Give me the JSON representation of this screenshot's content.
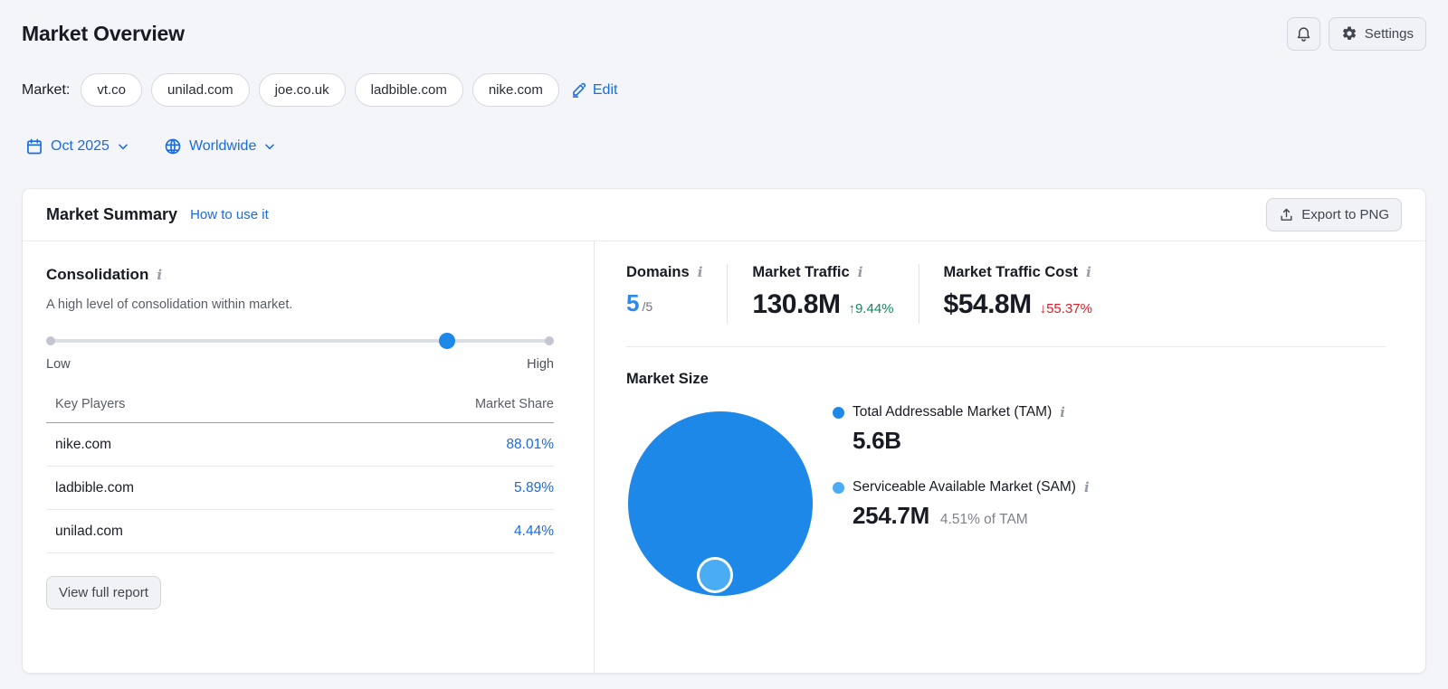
{
  "header": {
    "title": "Market Overview",
    "settings_button": "Settings",
    "market_label": "Market:",
    "market_chips": [
      "vt.co",
      "unilad.com",
      "joe.co.uk",
      "ladbible.com",
      "nike.com"
    ],
    "edit_link": "Edit",
    "date_filter": "Oct 2025",
    "region_filter": "Worldwide"
  },
  "summary_card": {
    "title": "Market Summary",
    "help_link": "How to use it",
    "export_button": "Export to PNG"
  },
  "consolidation": {
    "title": "Consolidation",
    "description": "A high level of consolidation within market.",
    "slider": {
      "low_label": "Low",
      "high_label": "High",
      "value_percent": 79
    },
    "table": {
      "headers": [
        "Key Players",
        "Market Share"
      ],
      "rows": [
        {
          "domain": "nike.com",
          "share": "88.01%"
        },
        {
          "domain": "ladbible.com",
          "share": "5.89%"
        },
        {
          "domain": "unilad.com",
          "share": "4.44%"
        }
      ]
    },
    "view_report_button": "View full report"
  },
  "metrics": [
    {
      "label": "Domains",
      "value": "5",
      "suffix": "/5"
    },
    {
      "label": "Market Traffic",
      "value": "130.8M",
      "change": "↑9.44%",
      "direction": "up"
    },
    {
      "label": "Market Traffic Cost",
      "value": "$54.8M",
      "change": "↓55.37%",
      "direction": "down"
    }
  ],
  "market_size": {
    "title": "Market Size",
    "tam": {
      "label": "Total Addressable Market (TAM)",
      "value": "5.6B"
    },
    "sam": {
      "label": "Serviceable Available Market (SAM)",
      "value": "254.7M",
      "note": "4.51% of TAM"
    }
  },
  "chart_data": {
    "type": "bubble",
    "title": "Market Size",
    "series": [
      {
        "name": "Total Addressable Market (TAM)",
        "value_display": "5.6B",
        "value": 5600000000,
        "color": "#1e88e8"
      },
      {
        "name": "Serviceable Available Market (SAM)",
        "value_display": "254.7M",
        "value": 254700000,
        "percent_of_tam": "4.51%",
        "color": "#4aacf2"
      }
    ]
  },
  "colors": {
    "link_blue": "#1a6be0",
    "domains_blue": "#2e8ae8",
    "tam_blue": "#1e88e8",
    "sam_blue": "#4aacf2",
    "positive_green": "#0c8a62",
    "negative_red": "#dc1c28",
    "page_background": "#f4f5f9"
  }
}
